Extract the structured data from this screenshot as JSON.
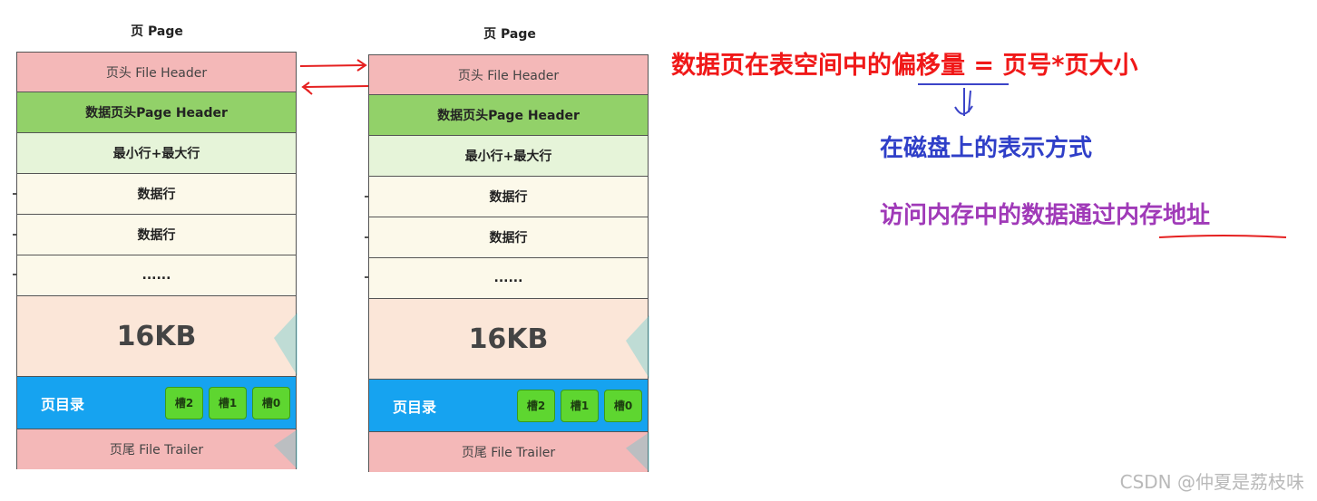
{
  "pages": [
    {
      "title": "页 Page",
      "file_header": "页头 File Header",
      "page_header": "数据页头Page Header",
      "min_max_rows": "最小行+最大行",
      "data_rows": [
        "数据行",
        "数据行"
      ],
      "ellipsis": "......",
      "size": "16KB",
      "directory": {
        "label": "页目录",
        "slots": [
          "槽2",
          "槽1",
          "槽0"
        ]
      },
      "file_trailer": "页尾 File Trailer"
    },
    {
      "title": "页 Page",
      "file_header": "页头 File Header",
      "page_header": "数据页头Page Header",
      "min_max_rows": "最小行+最大行",
      "data_rows": [
        "数据行",
        "数据行"
      ],
      "ellipsis": "......",
      "size": "16KB",
      "directory": {
        "label": "页目录",
        "slots": [
          "槽2",
          "槽1",
          "槽0"
        ]
      },
      "file_trailer": "页尾 File Trailer"
    }
  ],
  "annotations": {
    "offset_formula": "数据页在表空间中的偏移量 = 页号*页大小",
    "disk_representation": "在磁盘上的表示方式",
    "memory_access": "访问内存中的数据通过内存地址"
  },
  "watermark": "CSDN @仲夏是荔枝味",
  "colors": {
    "file_header": "#f4b8b8",
    "page_header": "#92d169",
    "min_max_rows": "#e6f4d9",
    "data_rows": "#fcf9ea",
    "size_area": "#fbe6d8",
    "directory": "#16a3f0",
    "slot": "#5ed630",
    "offset_text": "#f01818",
    "disk_text": "#2f3fc8",
    "memory_text": "#a03ab8"
  }
}
